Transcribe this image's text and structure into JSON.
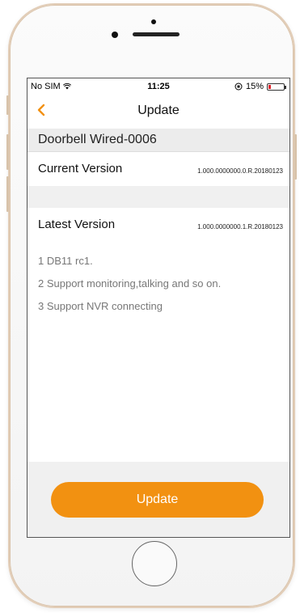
{
  "status_bar": {
    "carrier": "No SIM",
    "time": "11:25",
    "battery_percent": "15%",
    "battery_level": 0.15,
    "battery_color": "#e2262f"
  },
  "nav": {
    "back_icon": "chevron-left-icon",
    "title": "Update",
    "accent_color": "#f29111"
  },
  "device": {
    "name": "Doorbell Wired-0006"
  },
  "current_version": {
    "label": "Current Version",
    "value": "1.000.0000000.0.R.20180123"
  },
  "latest_version": {
    "label": "Latest Version",
    "value": "1.000.0000000.1.R.20180123"
  },
  "release_notes": [
    "1 DB11 rc1.",
    "2 Support monitoring,talking and so on.",
    "3 Support NVR connecting"
  ],
  "update_button": {
    "label": "Update",
    "color": "#f29111"
  }
}
